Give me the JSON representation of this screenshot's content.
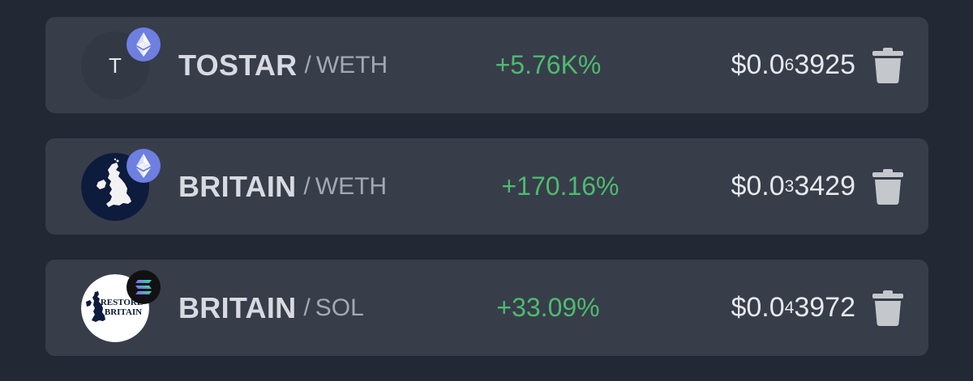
{
  "colors": {
    "background": "#222834",
    "card": "#383d4a",
    "positive": "#4dbb6e",
    "eth_badge": "#6d7fe0",
    "sol_badge": "#111111",
    "trash": "#c4c7cc"
  },
  "rows": [
    {
      "icon_letter": "T",
      "chain_icon": "ethereum-icon",
      "base": "TOSTAR",
      "separator": "/",
      "quote": "WETH",
      "change": "+5.76K%",
      "price_prefix": "$0.0",
      "price_zeros": "6",
      "price_digits": "3925"
    },
    {
      "token_icon": "britain-map-logo",
      "chain_icon": "ethereum-icon",
      "base": "BRITAIN",
      "separator": "/",
      "quote": "WETH",
      "change": "+170.16%",
      "price_prefix": "$0.0",
      "price_zeros": "3",
      "price_digits": "3429"
    },
    {
      "token_icon": "restore-britain-logo",
      "logo_text_line1": "RESTORE",
      "logo_text_line2": "BRITAIN",
      "chain_icon": "solana-icon",
      "base": "BRITAIN",
      "separator": "/",
      "quote": "SOL",
      "change": "+33.09%",
      "price_prefix": "$0.0",
      "price_zeros": "4",
      "price_digits": "3972"
    }
  ]
}
